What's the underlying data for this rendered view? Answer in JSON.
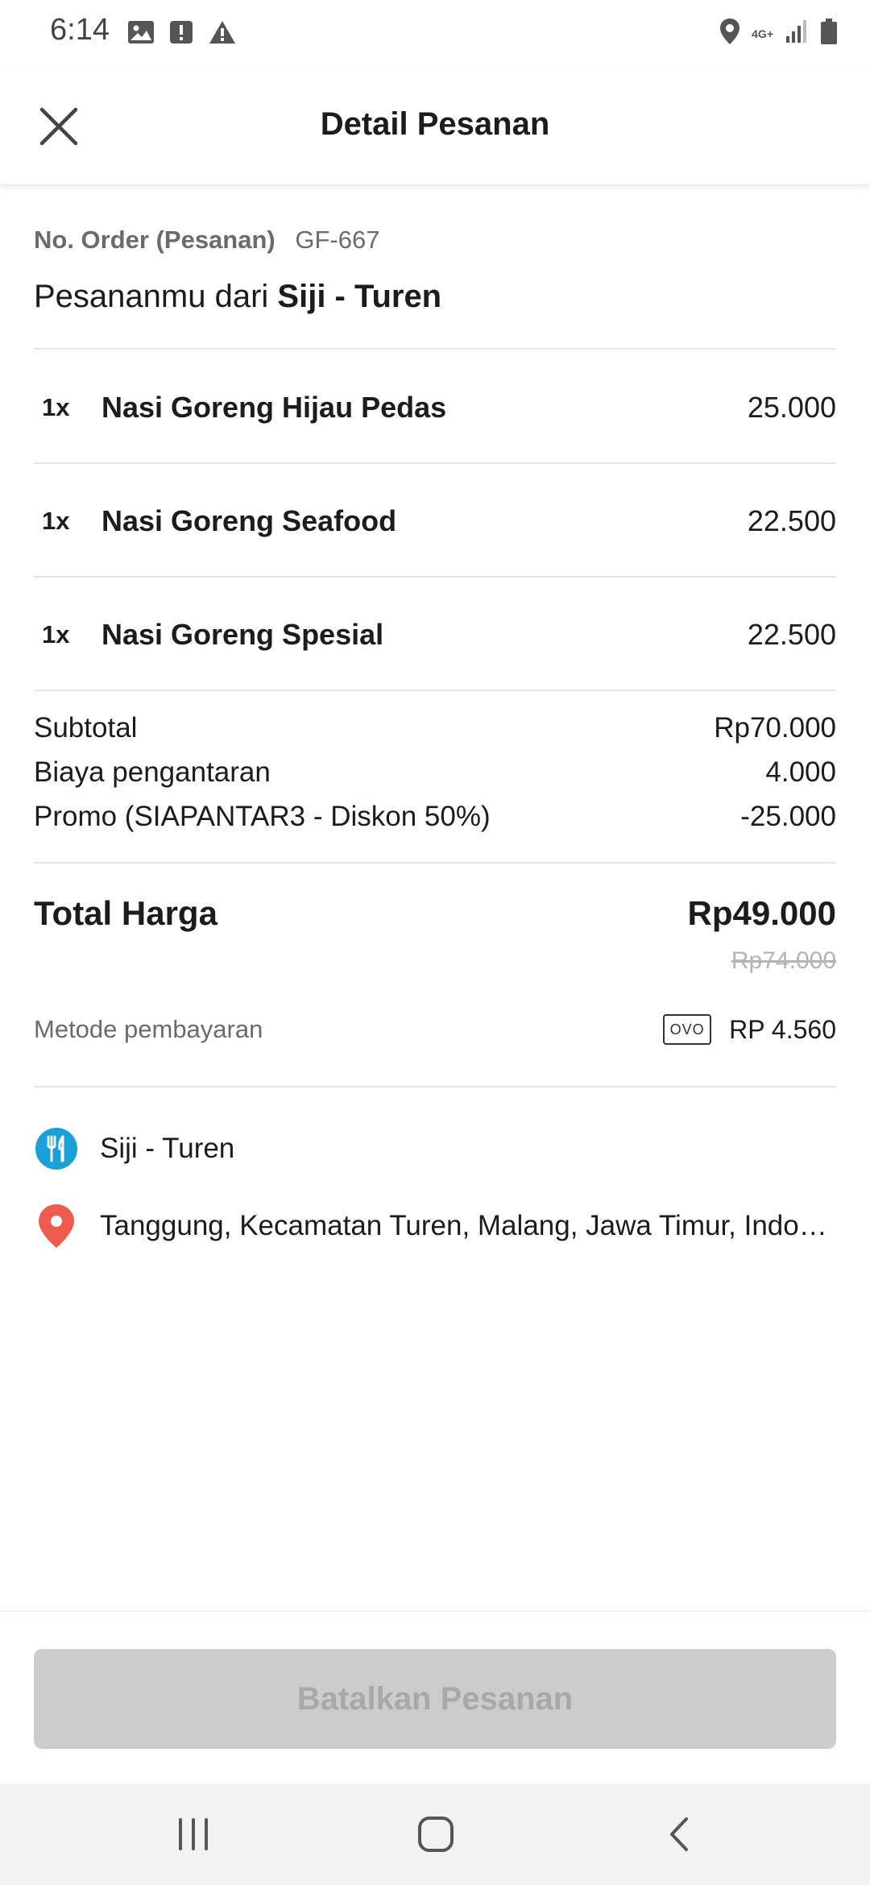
{
  "status_bar": {
    "time": "6:14",
    "network_label": "4G+",
    "icons": [
      "image-icon",
      "alert-square-icon",
      "warning-icon",
      "location-icon",
      "signal-icon",
      "battery-icon"
    ]
  },
  "header": {
    "title": "Detail Pesanan",
    "close_icon": "close-icon"
  },
  "order": {
    "number_label": "No. Order (Pesanan)",
    "number_value": "GF-667",
    "from_prefix": "Pesananmu dari ",
    "restaurant_name": "Siji - Turen"
  },
  "items": [
    {
      "qty": "1x",
      "name": "Nasi Goreng Hijau Pedas",
      "price": "25.000"
    },
    {
      "qty": "1x",
      "name": "Nasi Goreng Seafood",
      "price": "22.500"
    },
    {
      "qty": "1x",
      "name": "Nasi Goreng Spesial",
      "price": "22.500"
    }
  ],
  "summary": {
    "subtotal_label": "Subtotal",
    "subtotal_value": "Rp70.000",
    "delivery_label": "Biaya pengantaran",
    "delivery_value": "4.000",
    "promo_label": "Promo (SIAPANTAR3 - Diskon 50%)",
    "promo_value": "-25.000"
  },
  "total": {
    "label": "Total Harga",
    "value": "Rp49.000",
    "original_value": "Rp74.000"
  },
  "payment": {
    "label": "Metode pembayaran",
    "method_badge": "OVO",
    "amount": "RP 4.560"
  },
  "locations": {
    "restaurant": "Siji - Turen",
    "restaurant_icon": "restaurant-icon",
    "address": "Tanggung, Kecamatan Turen, Malang, Jawa Timur, Indonesia",
    "address_icon": "map-pin-icon"
  },
  "actions": {
    "cancel_label": "Batalkan Pesanan"
  },
  "navigation": {
    "recents_icon": "recents-icon",
    "home_icon": "home-icon",
    "back_icon": "back-icon"
  },
  "colors": {
    "restaurant_icon": "#1a9fd6",
    "pin_icon": "#ef5b4c",
    "disabled_button_bg": "#cccccc",
    "disabled_button_text": "#a8a8a8"
  }
}
